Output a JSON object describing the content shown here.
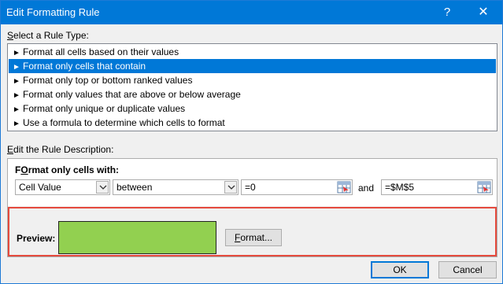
{
  "window": {
    "title": "Edit Formatting Rule",
    "help_glyph": "?",
    "close_glyph": "✕"
  },
  "rule_type": {
    "label_accel": "S",
    "label_rest": "elect a Rule Type:",
    "items": [
      {
        "label": "Format all cells based on their values",
        "selected": false
      },
      {
        "label": "Format only cells that contain",
        "selected": true
      },
      {
        "label": "Format only top or bottom ranked values",
        "selected": false
      },
      {
        "label": "Format only values that are above or below average",
        "selected": false
      },
      {
        "label": "Format only unique or duplicate values",
        "selected": false
      },
      {
        "label": "Use a formula to determine which cells to format",
        "selected": false
      }
    ]
  },
  "description": {
    "label_accel": "E",
    "label_rest": "dit the Rule Description:",
    "format_only_accel": "O",
    "format_only_pre": "F",
    "format_only_rest": "rmat only cells with:",
    "field_combo": "Cell Value",
    "operator_combo": "between",
    "value1": "=0",
    "and_label": "and",
    "value2": "=$M$5"
  },
  "preview": {
    "label": "Preview:",
    "swatch_color": "#92d050",
    "format_button_accel": "F",
    "format_button_rest": "ormat..."
  },
  "buttons": {
    "ok": "OK",
    "cancel": "Cancel"
  },
  "colors": {
    "accent": "#0078d7",
    "highlight_border": "#e54a3d"
  }
}
